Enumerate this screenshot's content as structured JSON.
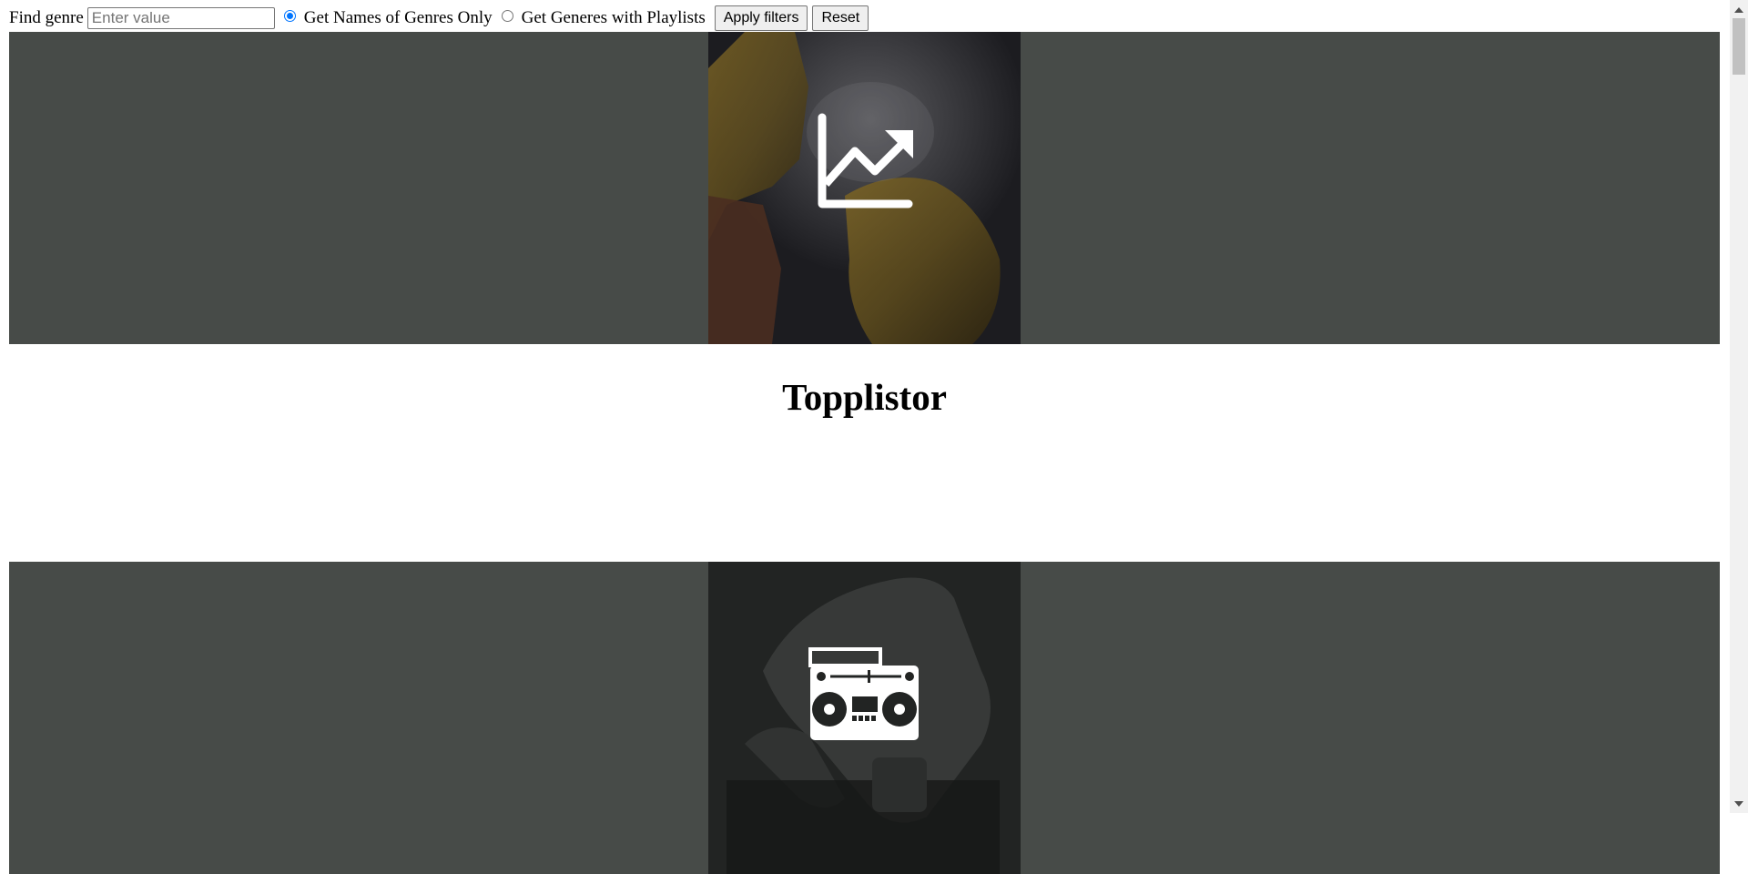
{
  "filters": {
    "find_label": "Find genre",
    "input_placeholder": "Enter value",
    "input_value": "",
    "radio_names_only": "Get Names of Genres Only",
    "radio_with_playlists": "Get Generes with Playlists",
    "selected_option": "Get Names of Genres Only",
    "apply_label": "Apply filters",
    "reset_label": "Reset"
  },
  "sections": [
    {
      "title": "Topplistor",
      "icon": "trending-up-icon"
    },
    {
      "title": "",
      "icon": "boombox-icon"
    }
  ],
  "colors": {
    "banner_bg": "#474b48",
    "radio_accent": "#0075ff"
  }
}
